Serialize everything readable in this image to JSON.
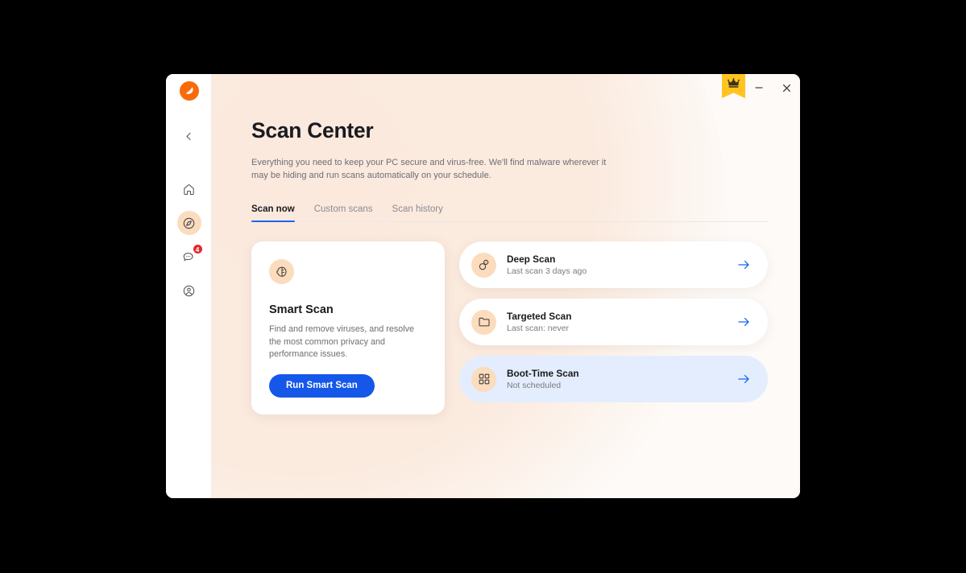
{
  "window": {
    "titlebar": {
      "premium_button": "premium-crown-ribbon",
      "minimize_label": "Minimize",
      "close_label": "Close"
    }
  },
  "sidebar": {
    "logo": "avast-logo-icon",
    "collapse": {
      "label": "Collapse sidebar",
      "icon": "chevron-left-icon"
    },
    "items": [
      {
        "id": "home",
        "icon": "home-icon",
        "label": "Home",
        "active": false,
        "badge": ""
      },
      {
        "id": "explore",
        "icon": "compass-icon",
        "label": "Explore",
        "active": true,
        "badge": ""
      },
      {
        "id": "messages",
        "icon": "chat-bubble-icon",
        "label": "Messages",
        "active": false,
        "badge": "4"
      },
      {
        "id": "account",
        "icon": "user-circle-icon",
        "label": "Account",
        "active": false,
        "badge": ""
      }
    ]
  },
  "page": {
    "title": "Scan Center",
    "subtitle": "Everything you need to keep your PC secure and virus-free. We'll find malware wherever it may be hiding and run scans automatically on your schedule."
  },
  "tabs": [
    {
      "label": "Scan now",
      "active": true
    },
    {
      "label": "Custom scans",
      "active": false
    },
    {
      "label": "Scan history",
      "active": false
    }
  ],
  "smart_scan": {
    "icon": "brain-icon",
    "title": "Smart Scan",
    "description": "Find and remove viruses, and resolve the most common privacy and performance issues.",
    "button_label": "Run Smart Scan"
  },
  "scan_list": [
    {
      "icon": "magnifier-icon",
      "name": "Deep Scan",
      "meta": "Last scan 3 days ago",
      "highlight": false,
      "arrow": "arrow-right-icon"
    },
    {
      "icon": "folder-icon",
      "name": "Targeted Scan",
      "meta": "Last scan: never",
      "highlight": false,
      "arrow": "arrow-right-icon"
    },
    {
      "icon": "grid-icon",
      "name": "Boot-Time Scan",
      "meta": "Not scheduled",
      "highlight": true,
      "arrow": "arrow-right-icon"
    }
  ],
  "colors": {
    "brand_orange": "#f96a0b",
    "accent_blue": "#1557e8",
    "tab_underline": "#1a66f0",
    "icon_bg_peach": "#fbdcbd",
    "highlight_blue": "#e3edfd",
    "badge_red": "#e3262d",
    "premium_yellow": "#ffc421",
    "page_bg": "#fdfaf7"
  }
}
